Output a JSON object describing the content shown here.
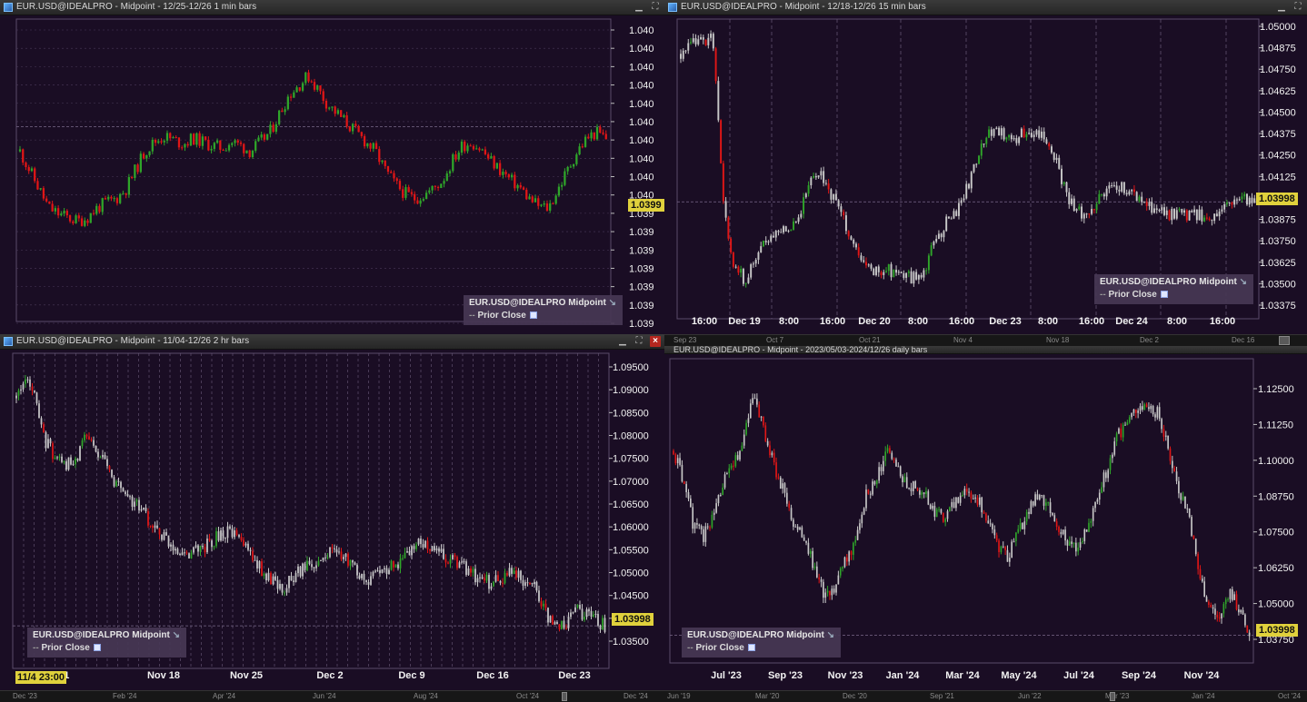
{
  "colors": {
    "background": "#1a0d24",
    "up": "#2fa52a",
    "down": "#e01616",
    "neutral": "#c8c8c8",
    "grid": "#4a3a5a",
    "price_tag": "#e0d13c"
  },
  "panels": [
    {
      "title": "EUR.USD@IDEALPRO - Midpoint - 12/25-12/26 1 min bars",
      "legend_symbol": "EUR.USD@IDEALPRO Midpoint",
      "legend_prior": "Prior Close",
      "price_tag": "1.0399",
      "chart_data": {
        "type": "candlestick",
        "title": "EUR.USD@IDEALPRO - Midpoint - 12/25-12/26 1 min bars",
        "y_ticks": [
          "1.040",
          "1.040",
          "1.040",
          "1.040",
          "1.040",
          "1.040",
          "1.040",
          "1.040",
          "1.040",
          "1.040",
          "1.039",
          "1.039",
          "1.039",
          "1.039",
          "1.039",
          "1.039",
          "1.039"
        ],
        "ylim": [
          1.03895,
          1.04055
        ],
        "last": 1.03998,
        "path": [
          1.03985,
          1.03975,
          1.03965,
          1.03955,
          1.03952,
          1.0395,
          1.03948,
          1.0395,
          1.03955,
          1.03958,
          1.0396,
          1.03965,
          1.03975,
          1.03985,
          1.0399,
          1.03993,
          1.03991,
          1.03989,
          1.03992,
          1.0399,
          1.03988,
          1.03987,
          1.0399,
          1.03988,
          1.03985,
          1.0399,
          1.03995,
          1.04005,
          1.04015,
          1.0402,
          1.04025,
          1.04018,
          1.0401,
          1.04005,
          1.04,
          1.03995,
          1.0399,
          1.03985,
          1.03975,
          1.03968,
          1.03963,
          1.0396,
          1.03962,
          1.03965,
          1.0397,
          1.0398,
          1.03988,
          1.0399,
          1.03986,
          1.0398,
          1.03975,
          1.0397,
          1.03966,
          1.0396,
          1.03956,
          1.03955,
          1.03965,
          1.03975,
          1.03985,
          1.03992,
          1.03995,
          1.03992
        ],
        "x_ticks": []
      }
    },
    {
      "title": "EUR.USD@IDEALPRO - Midpoint - 12/18-12/26 15 min bars",
      "legend_symbol": "EUR.USD@IDEALPRO Midpoint",
      "legend_prior": "Prior Close",
      "price_tag": "1.03998",
      "chart_data": {
        "type": "candlestick",
        "title": "EUR.USD@IDEALPRO - Midpoint - 12/18-12/26 15 min bars",
        "y_ticks": [
          "1.05000",
          "1.04875",
          "1.04750",
          "1.04625",
          "1.04500",
          "1.04375",
          "1.04250",
          "1.04125",
          "1.04000",
          "1.03875",
          "1.03750",
          "1.03625",
          "1.03500",
          "1.03375"
        ],
        "ylim": [
          1.03325,
          1.0505
        ],
        "last": 1.03998,
        "x_ticks": [
          "16:00",
          "Dec 19",
          "8:00",
          "16:00",
          "Dec 20",
          "8:00",
          "16:00",
          "Dec 23",
          "8:00",
          "16:00",
          "Dec 24",
          "8:00",
          "16:00"
        ],
        "path": [
          1.0485,
          1.049,
          1.0493,
          1.0495,
          1.04,
          1.0362,
          1.0355,
          1.0365,
          1.0378,
          1.0382,
          1.0385,
          1.039,
          1.041,
          1.0418,
          1.0405,
          1.0395,
          1.0378,
          1.0365,
          1.036,
          1.0361,
          1.036,
          1.0358,
          1.0356,
          1.0362,
          1.0378,
          1.0388,
          1.0395,
          1.0408,
          1.0428,
          1.0442,
          1.044,
          1.0435,
          1.0438,
          1.044,
          1.0438,
          1.043,
          1.041,
          1.0395,
          1.0392,
          1.0398,
          1.0405,
          1.041,
          1.0406,
          1.0402,
          1.0398,
          1.0394,
          1.0392,
          1.0392,
          1.0393,
          1.0392,
          1.039,
          1.0395,
          1.04,
          1.0401,
          1.0398
        ]
      },
      "scroll_labels": [
        "Sep 23",
        "Oct 7",
        "Oct 21",
        "Nov 4",
        "Nov 18",
        "Dec 2",
        "Dec 16"
      ]
    },
    {
      "title": "EUR.USD@IDEALPRO - Midpoint - 11/04-12/26 2 hr bars",
      "legend_symbol": "EUR.USD@IDEALPRO Midpoint",
      "legend_prior": "Prior Close",
      "price_tag": "1.03998",
      "cursor_tag": "11/4 23:00",
      "chart_data": {
        "type": "candlestick",
        "title": "EUR.USD@IDEALPRO - Midpoint - 11/04-12/26 2 hr bars",
        "y_ticks": [
          "1.09500",
          "1.09000",
          "1.08500",
          "1.08000",
          "1.07500",
          "1.07000",
          "1.06500",
          "1.06000",
          "1.05500",
          "1.05000",
          "1.04500",
          "1.04000",
          "1.03500"
        ],
        "ylim": [
          1.031,
          1.0975
        ],
        "last": 1.03998,
        "x_ticks": [
          "v 11",
          "Nov 18",
          "Nov 25",
          "Dec 2",
          "Dec 9",
          "Dec 16",
          "Dec 23"
        ],
        "path": [
          1.088,
          1.092,
          1.079,
          1.075,
          1.074,
          1.08,
          1.076,
          1.07,
          1.067,
          1.064,
          1.06,
          1.057,
          1.055,
          1.056,
          1.058,
          1.06,
          1.058,
          1.054,
          1.05,
          1.048,
          1.051,
          1.053,
          1.055,
          1.056,
          1.052,
          1.05,
          1.051,
          1.053,
          1.055,
          1.058,
          1.056,
          1.054,
          1.052,
          1.05,
          1.049,
          1.051,
          1.05,
          1.048,
          1.041,
          1.04,
          1.043,
          1.042,
          1.04
        ]
      },
      "scroll_labels": [
        "Dec '23",
        "Feb '24",
        "Apr '24",
        "Jun '24",
        "Aug '24",
        "Oct '24",
        "Dec '24"
      ]
    },
    {
      "title": "EUR.USD@IDEALPRO - Midpoint - 2023/05/03-2024/12/26 daily bars",
      "legend_symbol": "EUR.USD@IDEALPRO Midpoint",
      "legend_prior": "Prior Close",
      "price_tag": "1.03998",
      "chart_data": {
        "type": "candlestick",
        "title": "EUR.USD@IDEALPRO - Midpoint - 2023/05/03-2024/12/26 daily bars",
        "y_ticks": [
          "1.12500",
          "1.11250",
          "1.10000",
          "1.08750",
          "1.07500",
          "1.06250",
          "1.05000",
          "1.03750"
        ],
        "ylim": [
          1.031,
          1.13
        ],
        "last": 1.03998,
        "x_ticks": [
          "Jul '23",
          "Sep '23",
          "Nov '23",
          "Jan '24",
          "Mar '24",
          "May '24",
          "Jul '24",
          "Sep '24",
          "Nov '24"
        ],
        "path": [
          1.1,
          1.09,
          1.075,
          1.072,
          1.08,
          1.09,
          1.095,
          1.105,
          1.12,
          1.105,
          1.095,
          1.086,
          1.076,
          1.07,
          1.062,
          1.052,
          1.055,
          1.065,
          1.07,
          1.085,
          1.09,
          1.1,
          1.095,
          1.09,
          1.088,
          1.085,
          1.08,
          1.078,
          1.084,
          1.088,
          1.085,
          1.078,
          1.07,
          1.065,
          1.072,
          1.08,
          1.085,
          1.082,
          1.075,
          1.07,
          1.068,
          1.075,
          1.085,
          1.095,
          1.105,
          1.11,
          1.115,
          1.115,
          1.112,
          1.1,
          1.088,
          1.08,
          1.06,
          1.05,
          1.045,
          1.055,
          1.048,
          1.04
        ]
      },
      "scroll_labels": [
        "Jun '19",
        "Mar '20",
        "Dec '20",
        "Sep '21",
        "Jun '22",
        "Mar '23",
        "Jan '24",
        "Oct '24"
      ]
    }
  ]
}
